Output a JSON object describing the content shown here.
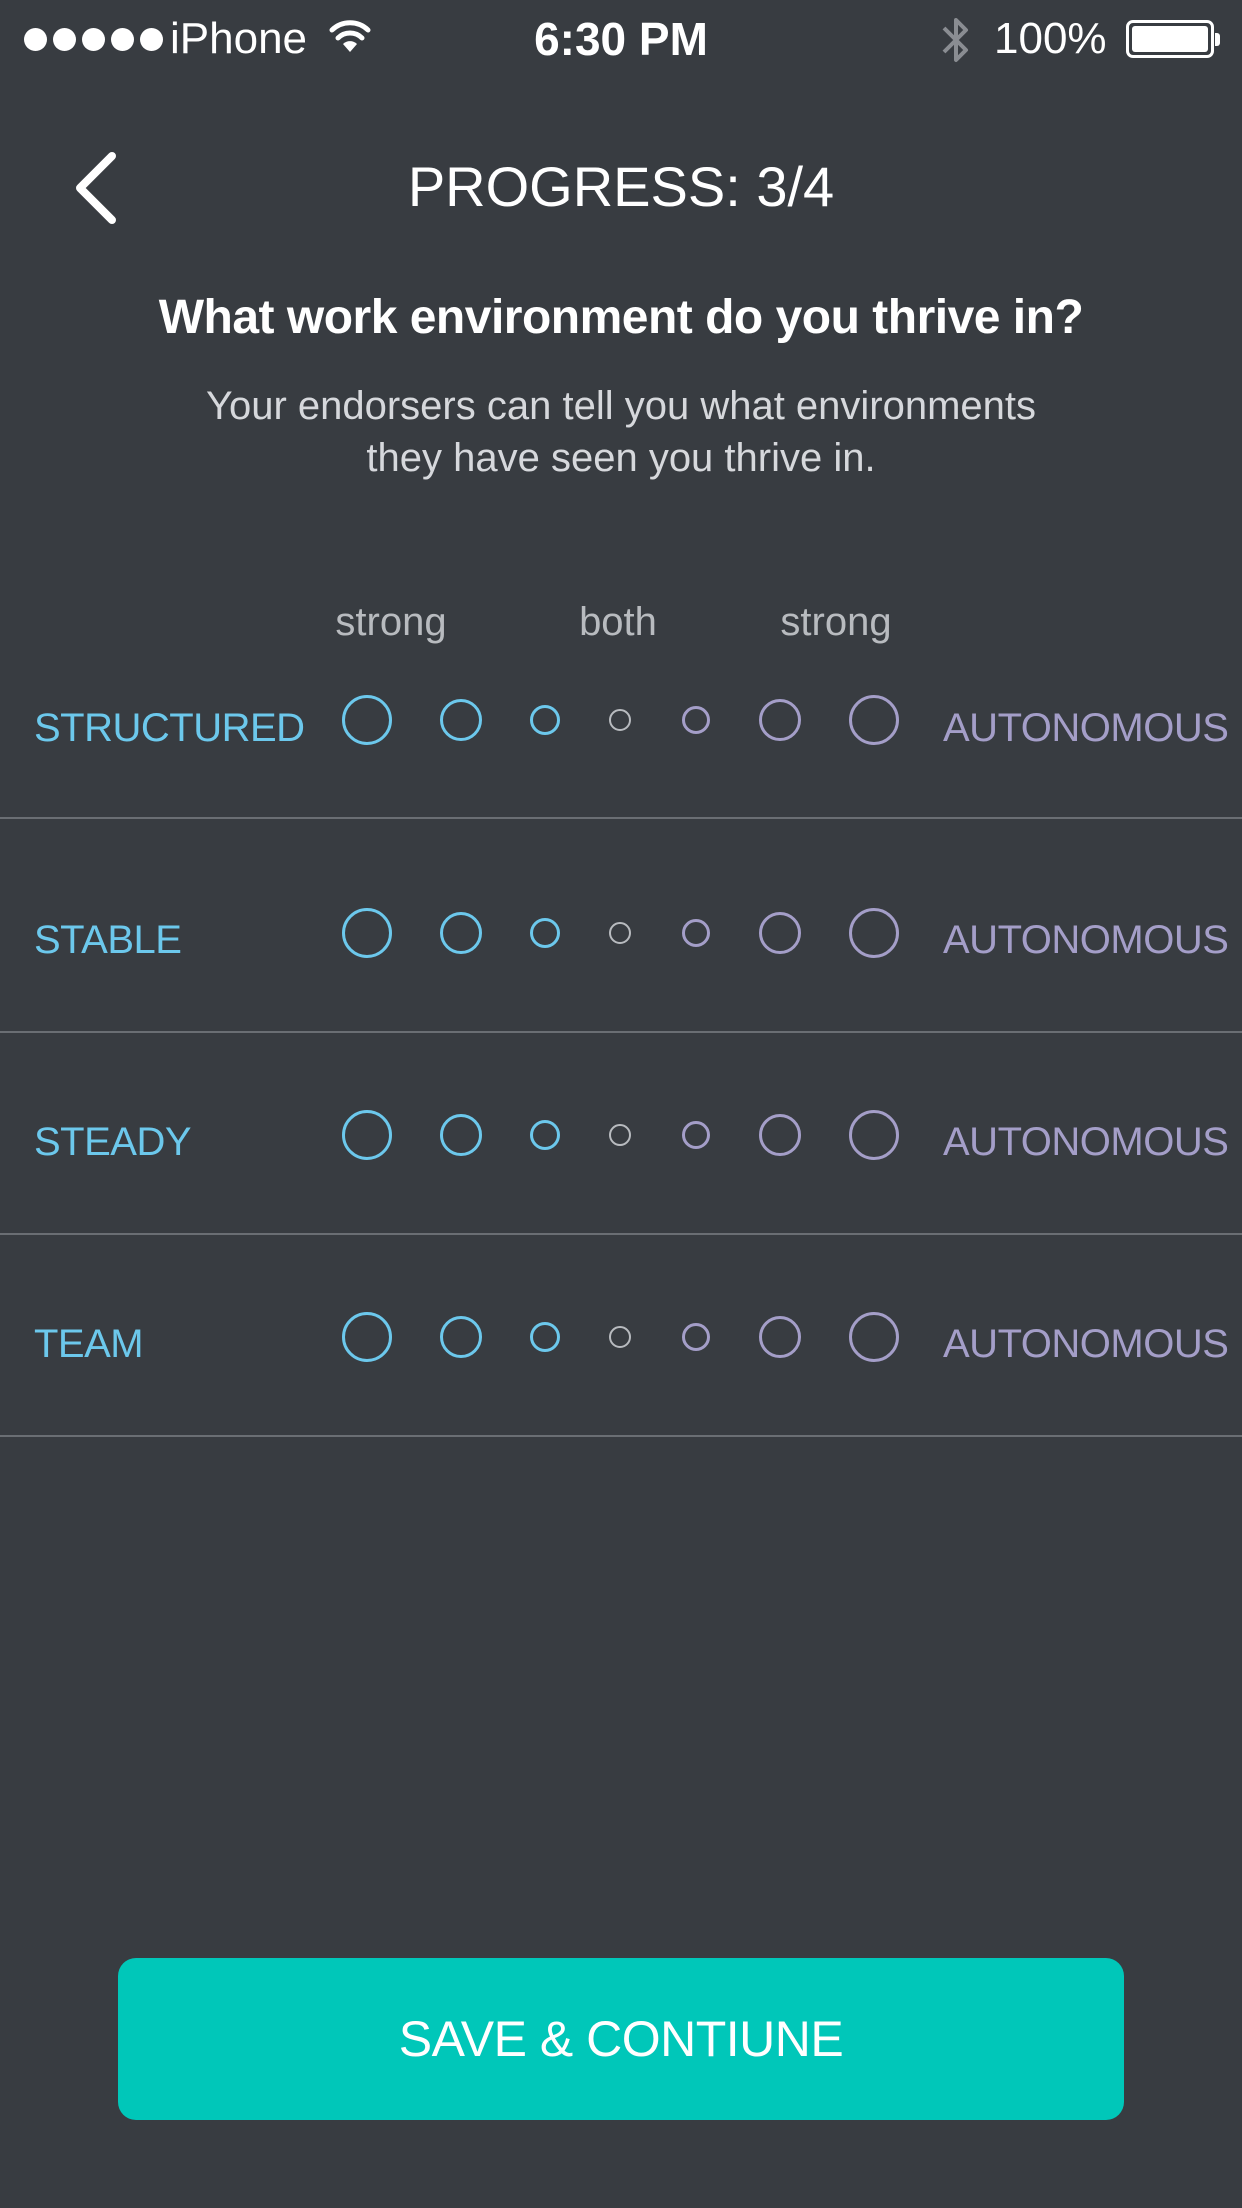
{
  "status_bar": {
    "carrier": "iPhone",
    "time": "6:30 PM",
    "battery": "100%",
    "signal_bars": 5
  },
  "nav": {
    "title": "PROGRESS: 3/4",
    "back_icon": "chevron-left-icon"
  },
  "question": {
    "title": "What work environment do you thrive in?",
    "subtitle": "Your endorsers can tell you what environments they have seen you thrive in."
  },
  "scale": {
    "left_label": "strong",
    "middle_label": "both",
    "right_label": "strong"
  },
  "rows": [
    {
      "left": "STRUCTURED",
      "right": "AUTONOMOUS"
    },
    {
      "left": "STABLE",
      "right": "AUTONOMOUS"
    },
    {
      "left": "STEADY",
      "right": "AUTONOMOUS"
    },
    {
      "left": "TEAM",
      "right": "AUTONOMOUS"
    }
  ],
  "colors": {
    "background": "#383c41",
    "left_accent": "#6cc8ec",
    "right_accent": "#a49ec8",
    "neutral": "#b8bbbf",
    "button": "#00c7b9"
  },
  "cta": {
    "label": "SAVE & CONTIUNE"
  }
}
